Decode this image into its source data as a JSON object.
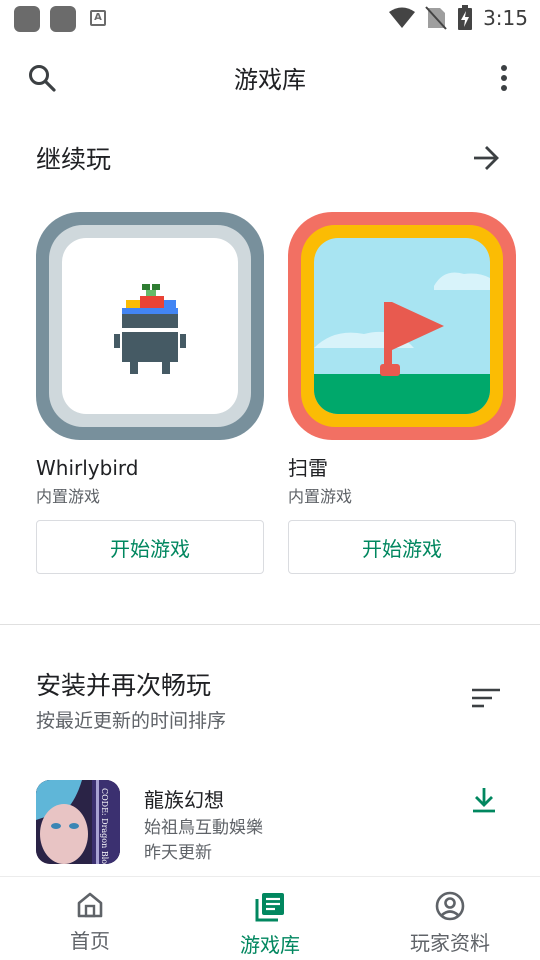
{
  "status_bar": {
    "time": "3:15"
  },
  "app_bar": {
    "title": "游戏库"
  },
  "continue_section": {
    "heading": "继续玩",
    "games": [
      {
        "name": "Whirlybird",
        "subtitle": "内置游戏",
        "button": "开始游戏",
        "icon": "whirlybird-icon"
      },
      {
        "name": "扫雷",
        "subtitle": "内置游戏",
        "button": "开始游戏",
        "icon": "minesweeper-icon"
      }
    ]
  },
  "installed_section": {
    "heading": "安装并再次畅玩",
    "subtitle": "按最近更新的时间排序",
    "apps": [
      {
        "name": "龍族幻想",
        "developer": "始祖鳥互動娛樂",
        "updated": "昨天更新",
        "icon_text": "CODE: Dragon Blood"
      }
    ]
  },
  "bottom_nav": [
    {
      "label": "首页",
      "icon": "home-icon",
      "active": false
    },
    {
      "label": "游戏库",
      "icon": "library-icon",
      "active": true
    },
    {
      "label": "玩家资料",
      "icon": "profile-icon",
      "active": false
    }
  ],
  "colors": {
    "accent": "#01875f",
    "text": "#202124",
    "secondary": "#5f6368"
  }
}
